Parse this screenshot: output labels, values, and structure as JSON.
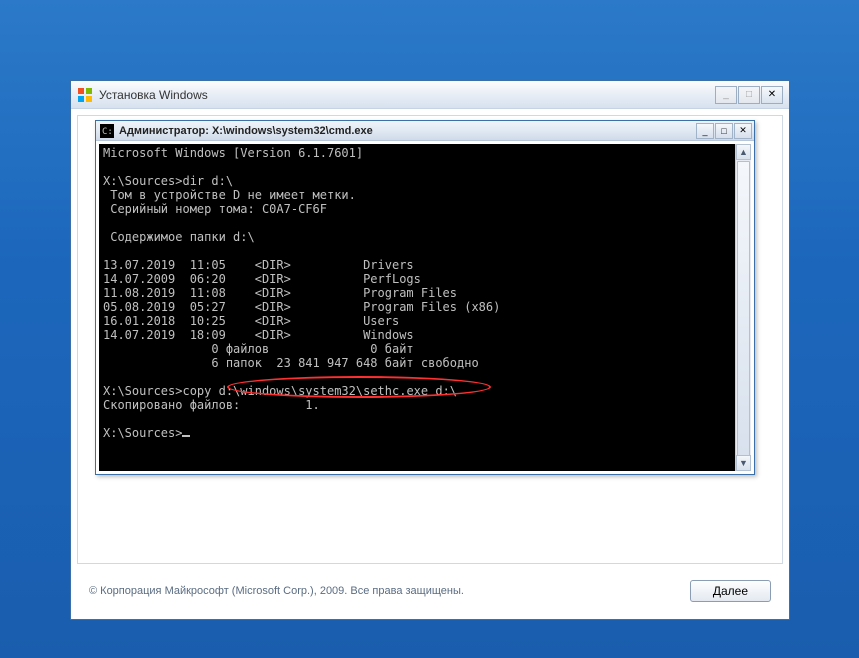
{
  "installer": {
    "title": "Установка Windows",
    "copyright": "© Корпорация Майкрософт (Microsoft Corp.), 2009. Все права защищены.",
    "next_button": "Далее"
  },
  "cmd": {
    "title": "Администратор: X:\\windows\\system32\\cmd.exe"
  },
  "console": {
    "version_line": "Microsoft Windows [Version 6.1.7601]",
    "prompt1": "X:\\Sources>",
    "cmd1": "dir d:\\",
    "vol_line": " Том в устройстве D не имеет метки.",
    "serial_line": " Серийный номер тома: C0A7-CF6F",
    "contents_line": " Содержимое папки d:\\",
    "entries": [
      "13.07.2019  11:05    <DIR>          Drivers",
      "14.07.2009  06:20    <DIR>          PerfLogs",
      "11.08.2019  11:08    <DIR>          Program Files",
      "05.08.2019  05:27    <DIR>          Program Files (x86)",
      "16.01.2018  10:25    <DIR>          Users",
      "14.07.2019  18:09    <DIR>          Windows"
    ],
    "summary_files": "               0 файлов              0 байт",
    "summary_dirs": "               6 папок  23 841 947 648 байт свободно",
    "prompt2": "X:\\Sources>",
    "cmd2_prefix": "copy ",
    "cmd2_highlighted": "d:\\windows\\system32\\sethc.exe d:\\",
    "copied_line": "Скопировано файлов:         1.",
    "prompt3": "X:\\Sources>"
  },
  "controls": {
    "minimize": "_",
    "maximize": "□",
    "close": "✕",
    "up": "▲",
    "down": "▼"
  }
}
